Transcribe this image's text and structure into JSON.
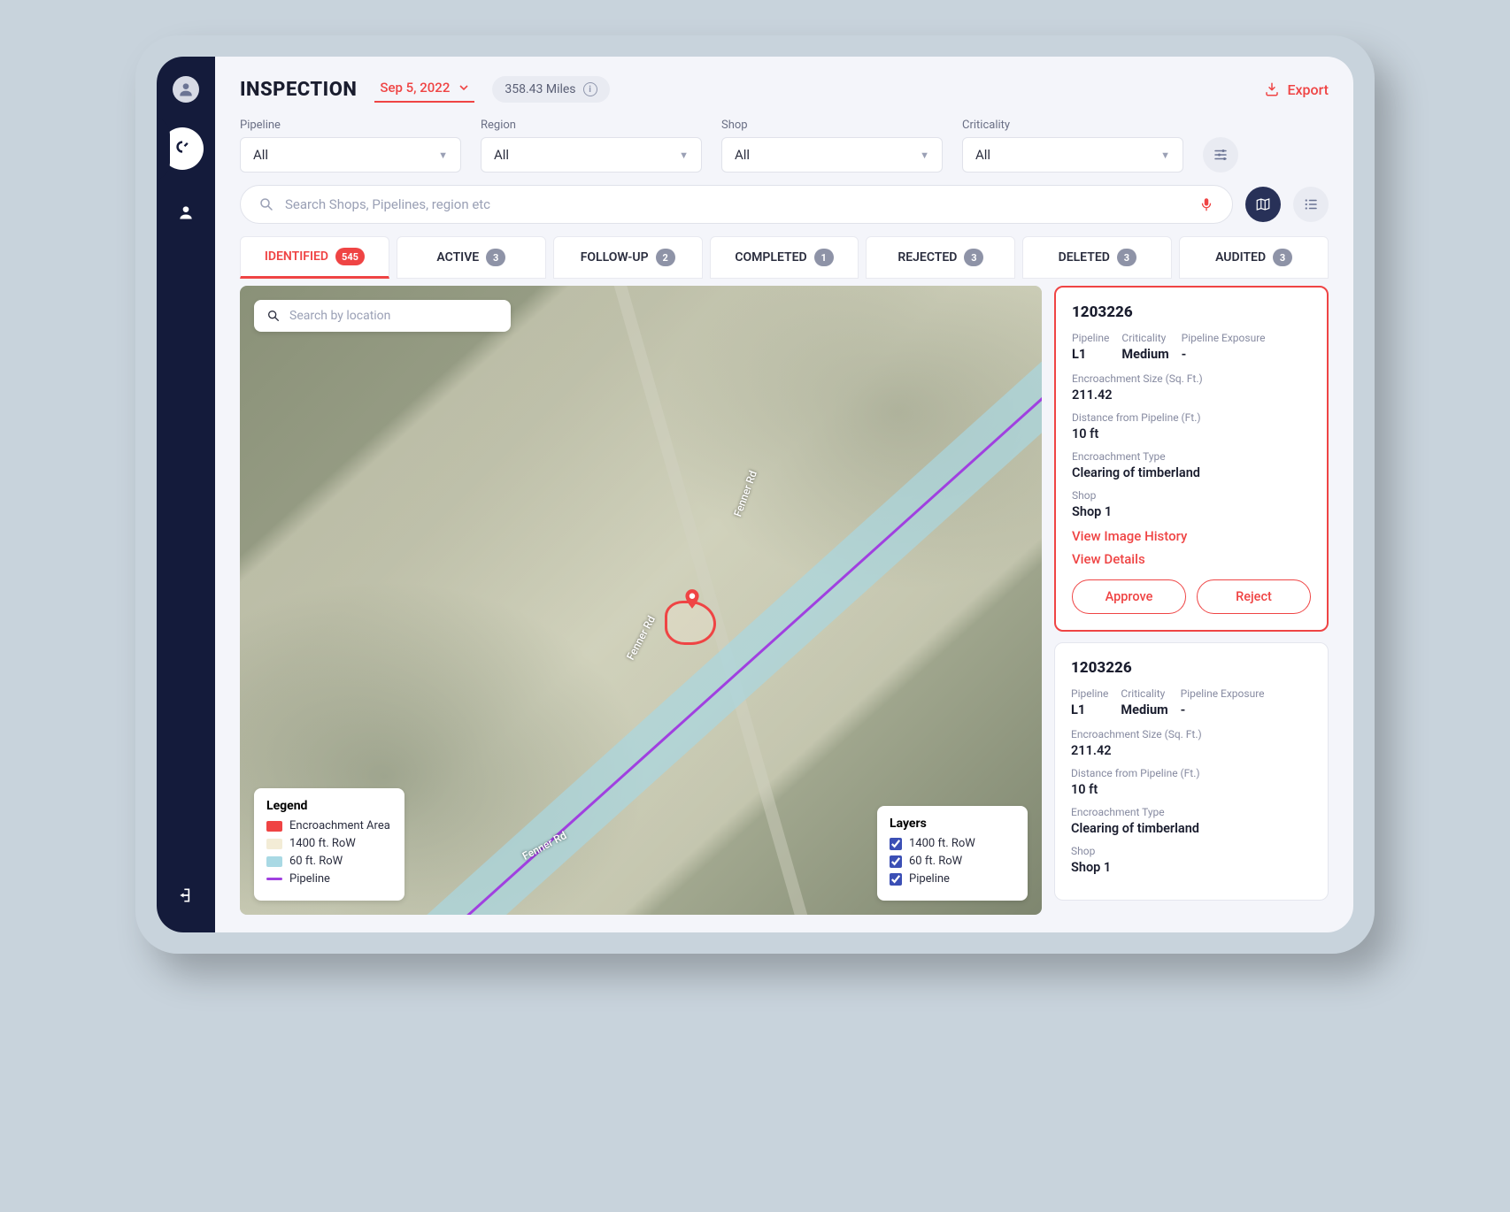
{
  "header": {
    "title": "INSPECTION",
    "date": "Sep 5, 2022",
    "miles": "358.43 Miles",
    "export_label": "Export"
  },
  "filters": {
    "pipeline": {
      "label": "Pipeline",
      "value": "All"
    },
    "region": {
      "label": "Region",
      "value": "All"
    },
    "shop": {
      "label": "Shop",
      "value": "All"
    },
    "criticality": {
      "label": "Criticality",
      "value": "All"
    }
  },
  "search": {
    "placeholder": "Search Shops, Pipelines, region etc"
  },
  "tabs": [
    {
      "label": "IDENTIFIED",
      "count": "545"
    },
    {
      "label": "ACTIVE",
      "count": "3"
    },
    {
      "label": "FOLLOW-UP",
      "count": "2"
    },
    {
      "label": "COMPLETED",
      "count": "1"
    },
    {
      "label": "REJECTED",
      "count": "3"
    },
    {
      "label": "DELETED",
      "count": "3"
    },
    {
      "label": "AUDITED",
      "count": "3"
    }
  ],
  "map": {
    "search_placeholder": "Search by location",
    "road_labels": [
      "Fenner Rd",
      "Fenner Rd",
      "Fenner Rd"
    ],
    "legend": {
      "title": "Legend",
      "items": [
        {
          "label": "Encroachment Area",
          "color": "#ef4444"
        },
        {
          "label": "1400 ft. RoW",
          "color": "#f3ecd6"
        },
        {
          "label": "60 ft. RoW",
          "color": "#a9d9e4"
        },
        {
          "label": "Pipeline",
          "color": "#a040e0"
        }
      ]
    },
    "layers": {
      "title": "Layers",
      "items": [
        {
          "label": "1400 ft. RoW",
          "checked": true
        },
        {
          "label": "60 ft. RoW",
          "checked": true
        },
        {
          "label": "Pipeline",
          "checked": true
        }
      ]
    }
  },
  "cards": [
    {
      "id": "1203226",
      "pipeline_label": "Pipeline",
      "pipeline": "L1",
      "criticality_label": "Criticality",
      "criticality": "Medium",
      "exposure_label": "Pipeline Exposure",
      "exposure": "-",
      "enc_size_label": "Encroachment Size (Sq. Ft.)",
      "enc_size": "211.42",
      "dist_label": "Distance from Pipeline (Ft.)",
      "dist": "10 ft",
      "enc_type_label": "Encroachment Type",
      "enc_type": "Clearing of timberland",
      "shop_label": "Shop",
      "shop": "Shop 1",
      "view_image_history": "View Image History",
      "view_details": "View Details",
      "approve": "Approve",
      "reject": "Reject"
    },
    {
      "id": "1203226",
      "pipeline_label": "Pipeline",
      "pipeline": "L1",
      "criticality_label": "Criticality",
      "criticality": "Medium",
      "exposure_label": "Pipeline Exposure",
      "exposure": "-",
      "enc_size_label": "Encroachment Size (Sq. Ft.)",
      "enc_size": "211.42",
      "dist_label": "Distance from Pipeline (Ft.)",
      "dist": "10 ft",
      "enc_type_label": "Encroachment Type",
      "enc_type": "Clearing of timberland",
      "shop_label": "Shop",
      "shop": "Shop 1"
    }
  ]
}
